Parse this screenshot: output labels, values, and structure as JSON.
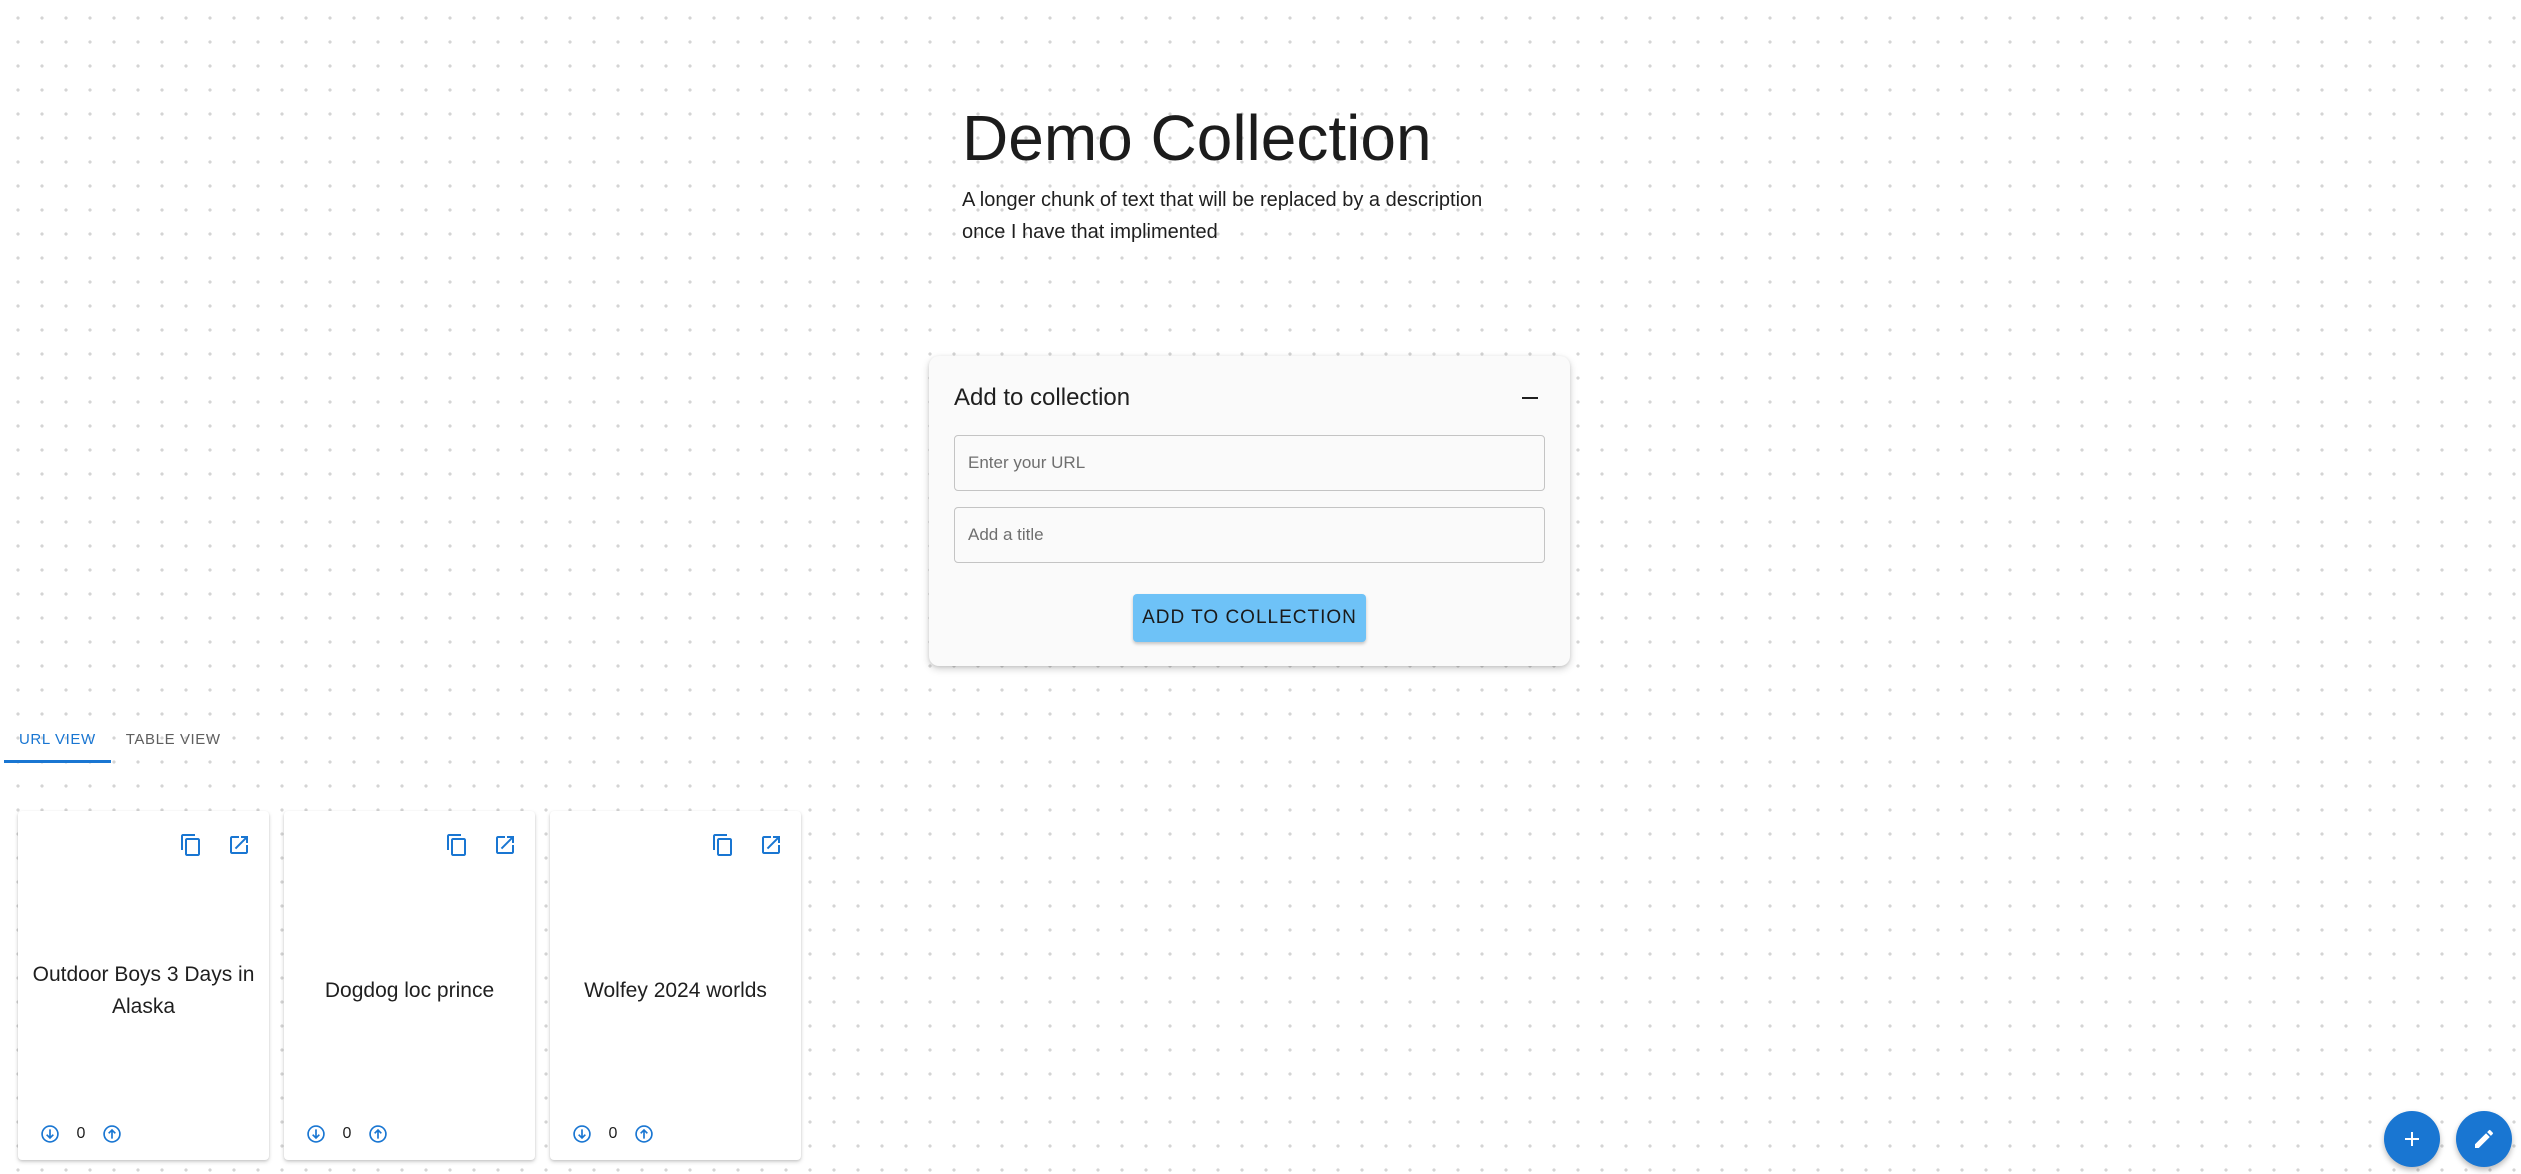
{
  "header": {
    "title": "Demo Collection",
    "description": "A longer chunk of text that will be replaced by a description once I have that implimented"
  },
  "add_panel": {
    "title": "Add to collection",
    "collapse_icon": "minus-icon",
    "url_placeholder": "Enter your URL",
    "title_placeholder": "Add a title",
    "button_label": "ADD TO COLLECTION",
    "button_color": "#6ec2f7"
  },
  "tabs": [
    {
      "label": "URL VIEW",
      "active": true
    },
    {
      "label": "TABLE VIEW",
      "active": false
    }
  ],
  "cards": [
    {
      "title": "Outdoor Boys 3 Days in Alaska",
      "votes": "0"
    },
    {
      "title": "Dogdog loc prince",
      "votes": "0"
    },
    {
      "title": "Wolfey 2024 worlds",
      "votes": "0"
    }
  ],
  "card_icons": {
    "copy": "copy-icon",
    "open": "open-in-new-icon",
    "downvote": "arrow-down-circle-icon",
    "upvote": "arrow-up-circle-icon"
  },
  "fabs": {
    "add": "add-icon",
    "edit": "edit-pencil-icon"
  },
  "colors": {
    "primary": "#1976d2",
    "text": "#1f1f1f"
  }
}
